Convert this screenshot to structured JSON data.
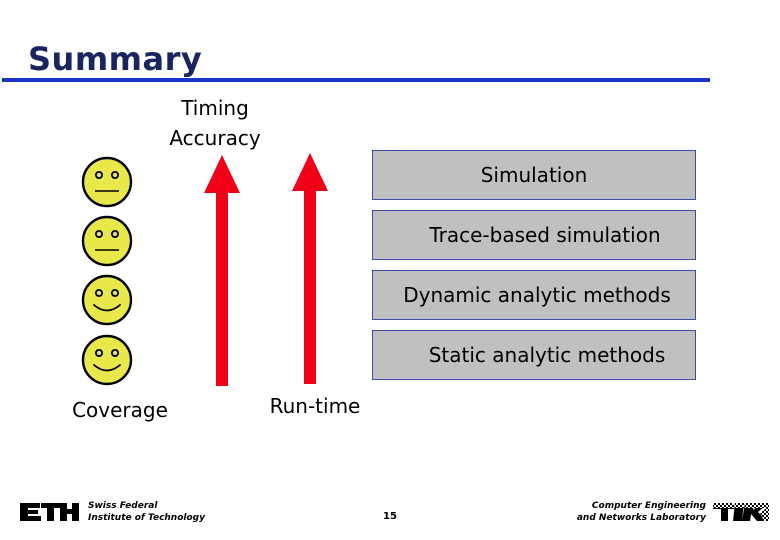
{
  "slide": {
    "title": "Summary",
    "page_number": "15",
    "accent_color": "#1a33c8",
    "title_color": "#1a2560",
    "box_fill_color": "#c0c0c0",
    "box_border_color": "#3b4fa8",
    "arrow_color": "#f20018",
    "face_fill_color": "#e8e84b"
  },
  "axes": {
    "vertical_label_line1": "Timing",
    "vertical_label_line2": "Accuracy",
    "bottom_left_label": "Coverage",
    "bottom_center_label": "Run-time"
  },
  "faces": [
    {
      "name": "face-neutral-1",
      "expression": "neutral"
    },
    {
      "name": "face-neutral-2",
      "expression": "neutral"
    },
    {
      "name": "face-smile-1",
      "expression": "smile"
    },
    {
      "name": "face-smile-2",
      "expression": "smile"
    }
  ],
  "arrows": [
    {
      "name": "arrow-up-left",
      "direction": "up"
    },
    {
      "name": "arrow-up-right",
      "direction": "up"
    }
  ],
  "methods": [
    {
      "label": "Simulation"
    },
    {
      "label": "Trace-based simulation"
    },
    {
      "label": "Dynamic analytic methods"
    },
    {
      "label": "Static analytic methods"
    }
  ],
  "footer": {
    "eth_logo_text": "ETH",
    "eth_line1": "Swiss Federal",
    "eth_line2": "Institute of Technology",
    "tik_line1": "Computer Engineering",
    "tik_line2": "and Networks Laboratory",
    "tik_logo_text": "TIK"
  }
}
